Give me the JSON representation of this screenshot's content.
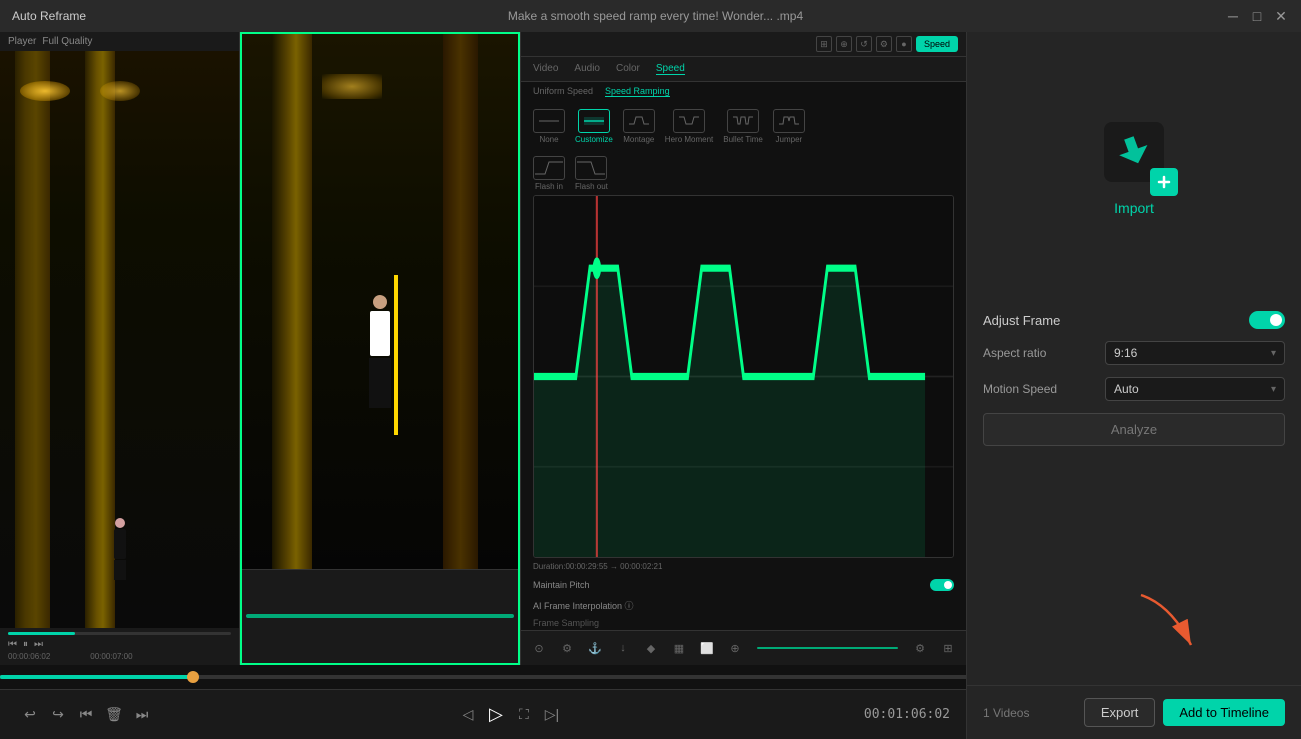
{
  "titleBar": {
    "appName": "Auto Reframe",
    "fileName": "Make a smooth speed ramp every time!  Wonder... .mp4",
    "minBtn": "─",
    "maxBtn": "□",
    "closeBtn": "✕"
  },
  "playerPanel": {
    "label": "Player",
    "quality": "Full Quality"
  },
  "speedPanel": {
    "tabs": [
      "Video",
      "Audio",
      "Color",
      "Speed"
    ],
    "activeTab": "Speed",
    "speedTypes": [
      "Uniform Speed",
      "Speed Ramping"
    ],
    "activeType": "Speed Ramping",
    "presets": [
      "None",
      "Customize",
      "Montage",
      "Hero Moment",
      "Bullet Time",
      "Jumper"
    ],
    "specialPresets": [
      "Flash in",
      "Flash out"
    ],
    "duration": "Duration:00:00:29:55 → 00:00:02:21",
    "maintainPitch": "Maintain Pitch",
    "aiFrame": "AI Frame Interpolation ⓘ",
    "frameSampling": "Frame Sampling"
  },
  "rightPanel": {
    "importLabel": "Import",
    "adjustFrame": "Adjust Frame",
    "aspectRatioLabel": "Aspect ratio",
    "aspectRatioValue": "9:16",
    "motionSpeedLabel": "Motion Speed",
    "motionSpeedValue": "Auto",
    "analyzeBtn": "Analyze"
  },
  "bottomBar": {
    "timeDisplay": "00:01:06:02",
    "videosCount": "1 Videos",
    "exportBtn": "Export",
    "addTimelineBtn": "Add to Timeline"
  },
  "controls": {
    "undo": "↩",
    "redo": "↪",
    "back": "⏮",
    "delete": "🗑",
    "forward": "⏭",
    "frameBack": "◁",
    "play": "▷",
    "frameForward": "▷|",
    "fullscreen": "⛶"
  }
}
